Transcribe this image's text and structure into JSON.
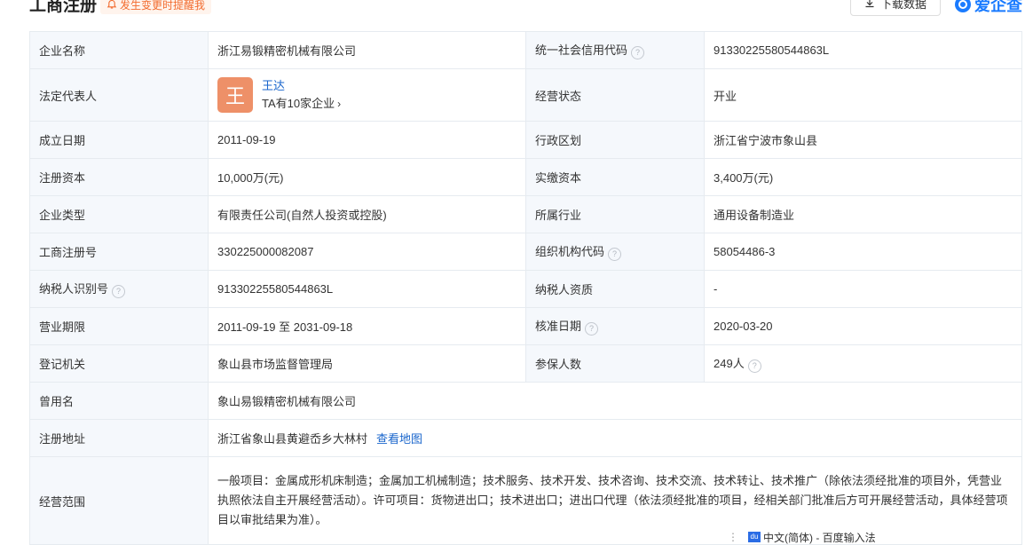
{
  "header": {
    "title": "工商注册",
    "remind_label": "发生变更时提醒我",
    "download_label": "下载数据",
    "brand": "爱企查"
  },
  "rows": {
    "company_name": {
      "label": "企业名称",
      "value": "浙江易锻精密机械有限公司"
    },
    "credit_code": {
      "label": "统一社会信用代码",
      "value": "91330225580544863L"
    },
    "legal_rep": {
      "label": "法定代表人",
      "avatar_char": "王",
      "name": "王达",
      "sub": "TA有10家企业"
    },
    "status": {
      "label": "经营状态",
      "value": "开业"
    },
    "found_date": {
      "label": "成立日期",
      "value": "2011-09-19"
    },
    "region": {
      "label": "行政区划",
      "value": "浙江省宁波市象山县"
    },
    "reg_capital": {
      "label": "注册资本",
      "value": "10,000万(元)"
    },
    "paid_capital": {
      "label": "实缴资本",
      "value": "3,400万(元)"
    },
    "company_type": {
      "label": "企业类型",
      "value": "有限责任公司(自然人投资或控股)"
    },
    "industry": {
      "label": "所属行业",
      "value": "通用设备制造业"
    },
    "reg_no": {
      "label": "工商注册号",
      "value": "330225000082087"
    },
    "org_code": {
      "label": "组织机构代码",
      "value": "58054486-3"
    },
    "taxpayer_id": {
      "label": "纳税人识别号",
      "value": "91330225580544863L"
    },
    "taxpayer_qual": {
      "label": "纳税人资质",
      "value": "-"
    },
    "biz_term": {
      "label": "营业期限",
      "value": "2011-09-19 至 2031-09-18"
    },
    "approve_date": {
      "label": "核准日期",
      "value": "2020-03-20"
    },
    "authority": {
      "label": "登记机关",
      "value": "象山县市场监督管理局"
    },
    "insured": {
      "label": "参保人数",
      "value": "249人"
    },
    "former_name": {
      "label": "曾用名",
      "value": "象山易锻精密机械有限公司"
    },
    "address": {
      "label": "注册地址",
      "value": "浙江省象山县黄避岙乡大林村",
      "map_link": "查看地图"
    },
    "scope": {
      "label": "经营范围",
      "value": "一般项目：金属成形机床制造；金属加工机械制造；技术服务、技术开发、技术咨询、技术交流、技术转让、技术推广（除依法须经批准的项目外，凭营业执照依法自主开展经营活动）。许可项目：货物进出口；技术进出口；进出口代理（依法须经批准的项目，经相关部门批准后方可开展经营活动，具体经营项目以审批结果为准）。"
    }
  },
  "ime": {
    "logo": "du",
    "text": "中文(简体) - 百度输入法"
  },
  "colors": {
    "accent": "#1a66cc",
    "avatar": "#ee9068",
    "label_bg": "#f5f8fc",
    "border": "#e6ebf0"
  }
}
